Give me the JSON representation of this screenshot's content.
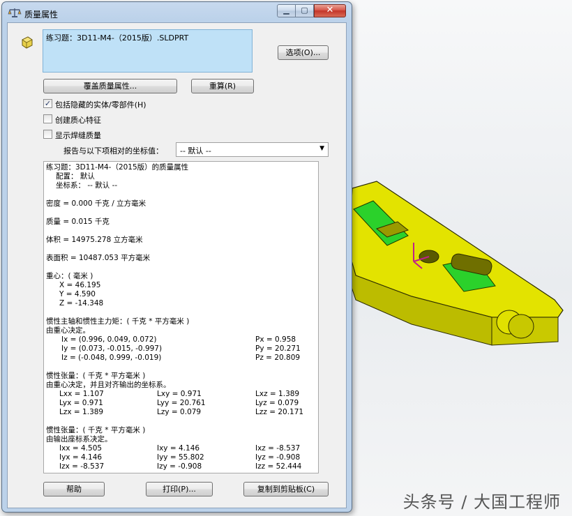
{
  "window": {
    "title": "质量属性"
  },
  "selection": {
    "text": "练习题：3D11-M4-（2015版）.SLDPRT"
  },
  "buttons": {
    "options": "选项(O)...",
    "override": "覆盖质量属性...",
    "recalculate": "重算(R)",
    "help": "帮助",
    "print": "打印(P)...",
    "copy": "复制到剪贴板(C)"
  },
  "options": {
    "include_hidden": {
      "label": "包括隐藏的实体/零部件(H)",
      "checked": true
    },
    "create_com": {
      "label": "创建质心特征",
      "checked": false
    },
    "show_weld": {
      "label": "显示焊缝质量",
      "checked": false
    }
  },
  "coord": {
    "label": "报告与以下项相对的坐标值：",
    "value": "-- 默认 --"
  },
  "report": {
    "header": "练习题：3D11-M4-（2015版）的质量属性",
    "config": "配置： 默认",
    "coordsys": "坐标系： -- 默认 --",
    "density": "密度 = 0.000 千克 / 立方毫米",
    "mass": "质量 = 0.015 千克",
    "volume": "体积 = 14975.278 立方毫米",
    "area": "表面积 = 10487.053  平方毫米",
    "com_title": "重心：( 毫米 )",
    "com_x": "X = 46.195",
    "com_y": "Y = 4.590",
    "com_z": "Z = -14.348",
    "principal_title": "惯性主轴和惯性主力矩：( 千克 *  平方毫米 )",
    "principal_sub": "由重心决定。",
    "ix": "Ix = (0.996,  0.049,  0.072)",
    "iy": "Iy = (0.073, -0.015, -0.997)",
    "iz": "Iz = (-0.048,  0.999, -0.019)",
    "px": "Px = 0.958",
    "py": "Py = 20.271",
    "pz": "Pz = 20.809",
    "tensor1_title": "惯性张量：( 千克 *  平方毫米 )",
    "tensor1_sub": "由重心决定，并且对齐输出的坐标系。",
    "lxx": "Lxx = 1.107",
    "lxy": "Lxy = 0.971",
    "lxz": "Lxz = 1.389",
    "lyx": "Lyx = 0.971",
    "lyy": "Lyy = 20.761",
    "lyz": "Lyz = 0.079",
    "lzx": "Lzx = 1.389",
    "lzy": "Lzy = 0.079",
    "lzz": "Lzz = 20.171",
    "tensor2_title": "惯性张量：( 千克 *  平方毫米 )",
    "tensor2_sub": "由输出座标系决定。",
    "ixx": "Ixx = 4.505",
    "ixy": "Ixy = 4.146",
    "ixz": "Ixz = -8.537",
    "iyx": "Iyx = 4.146",
    "iyy": "Iyy = 55.802",
    "iyz": "Iyz = -0.908",
    "izx": "Izx = -8.537",
    "izy": "Izy = -0.908",
    "izz": "Izz = 52.444"
  },
  "watermark": "头条号 / 大国工程师",
  "colors": {
    "part_yellow": "#e6e600",
    "part_green": "#22cc22",
    "selection_bg": "#bfe1f7"
  }
}
